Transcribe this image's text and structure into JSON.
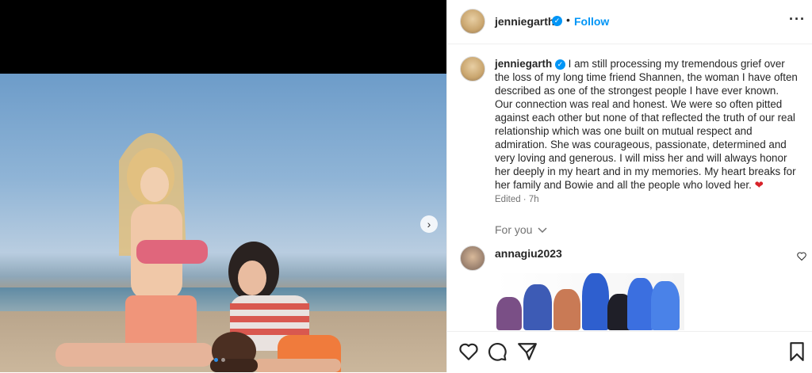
{
  "post": {
    "username": "jenniegarth",
    "follow_label": "Follow",
    "separator": "•",
    "more_label": "···",
    "caption": "I am still processing my tremendous grief over the loss of my long time friend Shannen, the woman I have often described as one of the strongest people I have ever known. Our connection was real and honest. We were so often pitted against each other but none of that reflected the truth of our real relationship which was one built on mutual respect and admiration. She was courageous, passionate, determined and very loving and generous. I will miss her and will always honor her deeply in my heart and in my memories. My heart breaks for her family and Bowie and all the people who loved her.",
    "caption_emoji": "❤",
    "edited": "Edited · 7h",
    "for_you": "For you",
    "next_arrow": "›"
  },
  "comment": {
    "username": "annagiu2023"
  },
  "icons": {
    "verified": "verified-badge-icon",
    "like": "heart-icon",
    "comment": "comment-icon",
    "share": "share-icon",
    "save": "bookmark-icon",
    "chevron": "chevron-down-icon"
  },
  "colors": {
    "accent": "#0095f6",
    "text": "#262626",
    "muted": "#737373"
  },
  "carousel": {
    "total_slides": 2,
    "active_slide": 1
  }
}
